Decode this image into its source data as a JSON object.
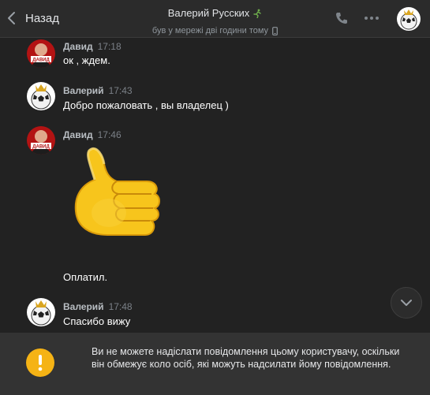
{
  "header": {
    "back_label": "Назад",
    "contact_name": "Валерий Русских",
    "status": "був у мережі дві години тому",
    "icons": [
      "chevron-left-icon",
      "runner-icon",
      "phone-icon",
      "more-icon",
      "mobile-icon"
    ]
  },
  "messages": [
    {
      "author": "Давид",
      "time": "17:18",
      "text": "ок , ждем.",
      "avatar_label": "ДАВИД"
    },
    {
      "author": "Валерий",
      "time": "17:43",
      "text": "Добро пожаловать , вы владелец )"
    },
    {
      "author": "Давид",
      "time": "17:46",
      "sticker": "thumbs-up-sticker",
      "text": "Оплатил.",
      "avatar_label": "ДАВИД"
    },
    {
      "author": "Валерий",
      "time": "17:48",
      "text": "Спасибо вижу"
    }
  ],
  "notice": {
    "text": "Ви не можете надіслати повідомлення цьому користувачу, оскільки він обмежує коло осіб, які можуть надсилати йому повідомлення."
  },
  "colors": {
    "background": "#222222",
    "header": "#2b2b2b",
    "notice_bg": "#333333",
    "warning": "#f5b315"
  }
}
